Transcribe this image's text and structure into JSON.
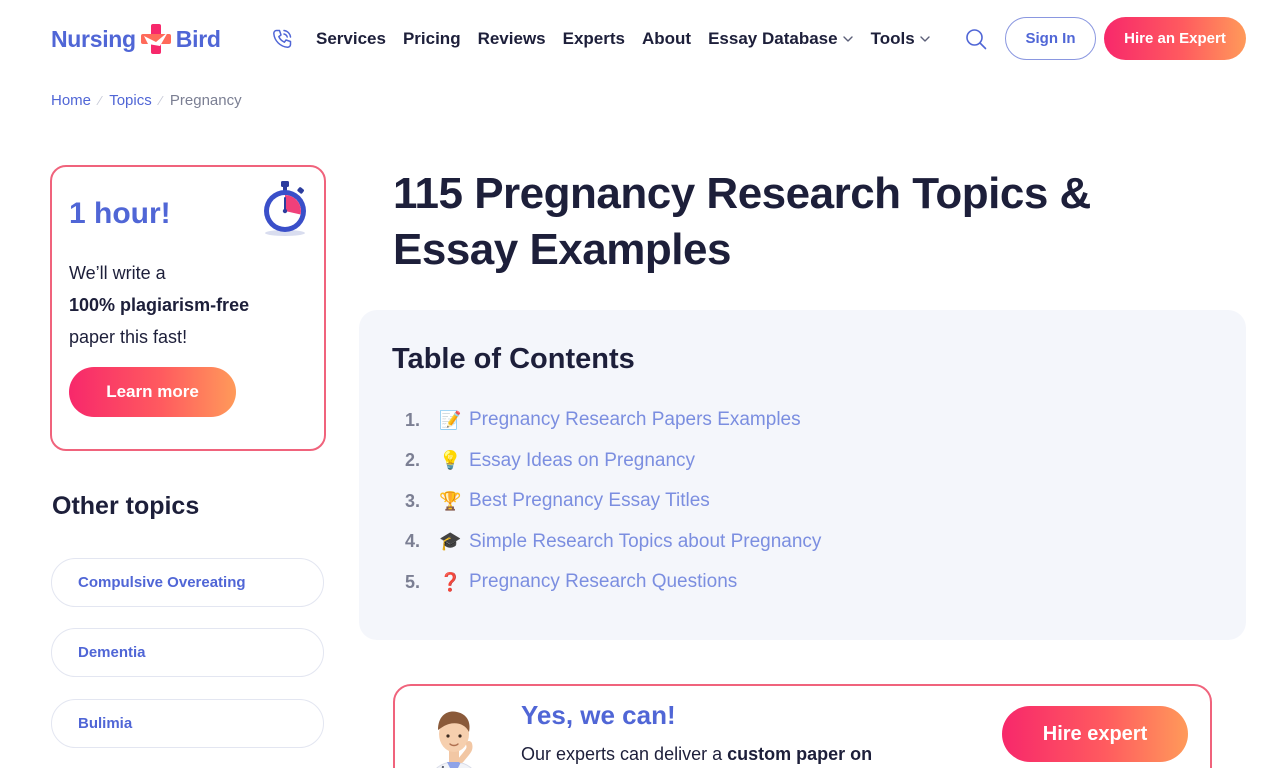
{
  "header": {
    "logo_left": "Nursing",
    "logo_right": "Bird",
    "nav": [
      {
        "label": "Services",
        "dropdown": false
      },
      {
        "label": "Pricing",
        "dropdown": false
      },
      {
        "label": "Reviews",
        "dropdown": false
      },
      {
        "label": "Experts",
        "dropdown": false
      },
      {
        "label": "About",
        "dropdown": false
      },
      {
        "label": "Essay Database",
        "dropdown": true
      },
      {
        "label": "Tools",
        "dropdown": true
      }
    ],
    "sign_in": "Sign In",
    "hire": "Hire an Expert",
    "icons": {
      "phone": "phone-icon",
      "search": "search-icon"
    }
  },
  "breadcrumb": {
    "home": "Home",
    "topics": "Topics",
    "current": "Pregnancy"
  },
  "promo": {
    "title": "1 hour!",
    "line1": "We’ll write a",
    "line2": "100% plagiarism-free",
    "line3": "paper this fast!",
    "button": "Learn more"
  },
  "other_topics": {
    "title": "Other topics",
    "items": [
      "Compulsive Overeating",
      "Dementia",
      "Bulimia"
    ]
  },
  "main": {
    "title": "115 Pregnancy Research Topics & Essay Examples",
    "toc": {
      "title": "Table of Contents",
      "items": [
        {
          "num": "1.",
          "emoji": "📝",
          "label": "Pregnancy Research Papers Examples"
        },
        {
          "num": "2.",
          "emoji": "💡",
          "label": "Essay Ideas on Pregnancy"
        },
        {
          "num": "3.",
          "emoji": "🏆",
          "label": "Best Pregnancy Essay Titles"
        },
        {
          "num": "4.",
          "emoji": "🎓",
          "label": "Simple Research Topics about Pregnancy"
        },
        {
          "num": "5.",
          "emoji": "❓",
          "label": "Pregnancy Research Questions"
        }
      ]
    }
  },
  "cta": {
    "title": "Yes, we can!",
    "text_plain": "Our experts can deliver a ",
    "text_bold": "custom paper on",
    "button": "Hire expert"
  },
  "colors": {
    "brand_blue": "#5066d6",
    "accent_pink": "#f7286b",
    "accent_orange": "#ff9a5a",
    "text_dark": "#1d1f3a"
  }
}
